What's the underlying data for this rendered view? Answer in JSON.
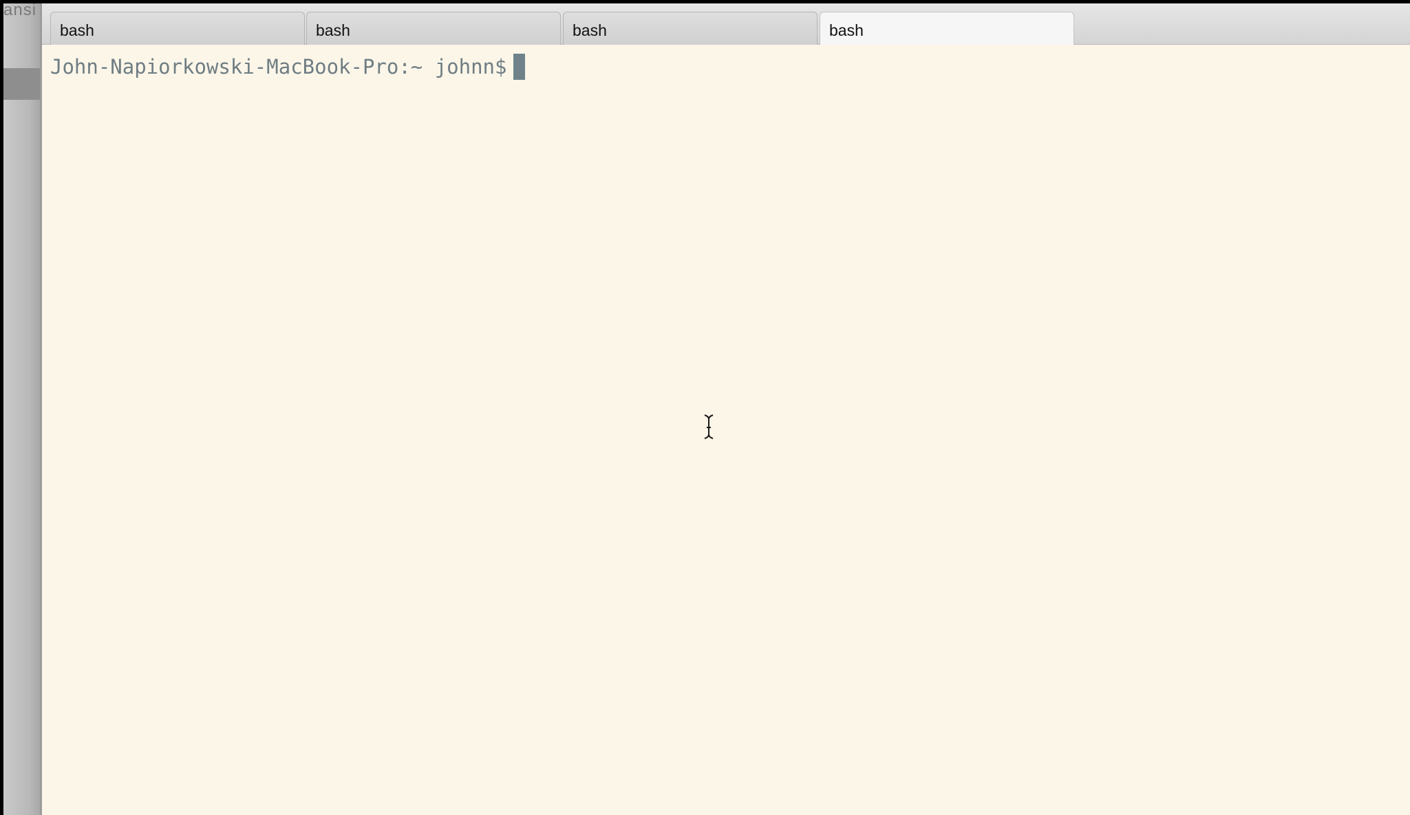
{
  "tabs": [
    {
      "label": "bash",
      "active": false
    },
    {
      "label": "bash",
      "active": false
    },
    {
      "label": "bash",
      "active": false
    },
    {
      "label": "bash",
      "active": true
    }
  ],
  "terminal": {
    "prompt": "John-Napiorkowski-MacBook-Pro:~ johnn$"
  },
  "background_window": {
    "visible_text": "ansi"
  },
  "icons": {
    "cursor": "text-cursor-block-icon",
    "mouse": "i-beam-cursor-icon"
  },
  "colors": {
    "terminal_background": "#fbf6e8",
    "prompt_text": "#6f7d83",
    "cursor": "#6f828a",
    "tab_bar": "#dcdcdc"
  }
}
